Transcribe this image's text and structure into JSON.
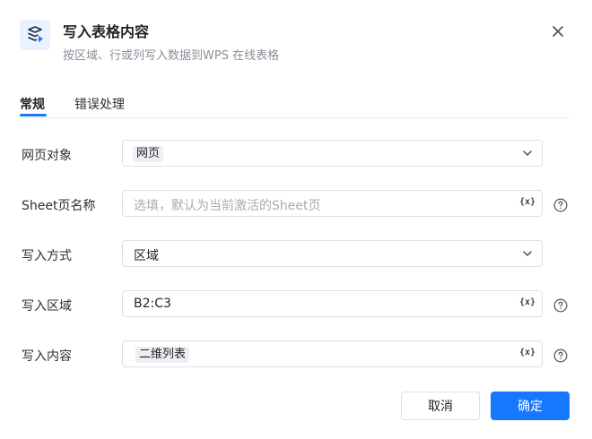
{
  "header": {
    "title": "写入表格内容",
    "subtitle": "按区域、行或列写入数据到WPS 在线表格",
    "icon": "table-write-icon",
    "close_icon": "close-icon"
  },
  "tabs": [
    {
      "label": "常规",
      "active": true
    },
    {
      "label": "错误处理",
      "active": false
    }
  ],
  "fields": {
    "web_object": {
      "label": "网页对象",
      "value": "网页"
    },
    "sheet_name": {
      "label": "Sheet页名称",
      "placeholder": "选填，默认为当前激活的Sheet页",
      "var": "{x}"
    },
    "write_mode": {
      "label": "写入方式",
      "value": "区域"
    },
    "write_range": {
      "label": "写入区域",
      "value": "B2:C3",
      "var": "{x}"
    },
    "write_content": {
      "label": "写入内容",
      "value": "二维列表",
      "var": "{x}"
    }
  },
  "footer": {
    "cancel_label": "取消",
    "ok_label": "确定"
  },
  "colors": {
    "accent": "#1677ff",
    "icon_bg": "#eaf1ff"
  }
}
